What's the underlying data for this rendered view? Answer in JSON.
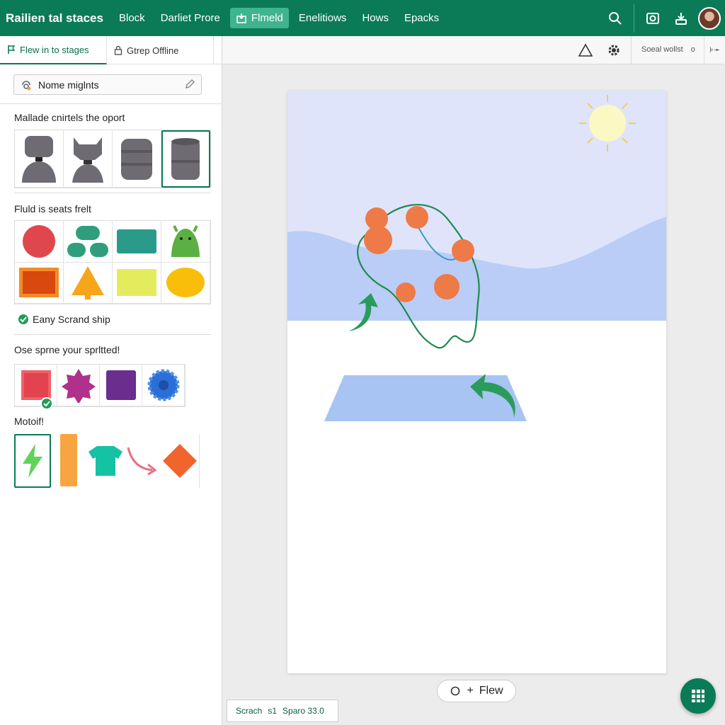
{
  "app": {
    "title": "Railien tal staces",
    "nav": [
      {
        "label": "Block",
        "active": false
      },
      {
        "label": "Darliet Prore",
        "active": false
      },
      {
        "label": "Flmeld",
        "active": true
      },
      {
        "label": "Enelitiows",
        "active": false
      },
      {
        "label": "Hows",
        "active": false
      },
      {
        "label": "Epacks",
        "active": false
      }
    ],
    "header_icons": [
      "search-icon",
      "camera-icon",
      "download-icon",
      "avatar"
    ]
  },
  "sidebar": {
    "tabs": [
      {
        "label": "Flew in to stages",
        "icon": "flag-icon",
        "active": true
      },
      {
        "label": "Gtrep Offline",
        "icon": "lock-icon",
        "active": false
      }
    ],
    "name_field": {
      "value": "Nome miglnts",
      "icon": "sprite-icon"
    },
    "section1": {
      "heading": "Mallade cnirtels the oport",
      "items": [
        "costume-1",
        "costume-2",
        "costume-3",
        "costume-4"
      ],
      "selected": 3
    },
    "section2": {
      "heading": "Fluld is seats frelt",
      "items": [
        "red-circle",
        "green-blob",
        "teal-rect",
        "green-monster",
        "orange-square",
        "orange-triangle",
        "yellow-rect",
        "yellow-ellipse"
      ]
    },
    "option": {
      "label": "Eany Scrand ship",
      "checked": true
    },
    "section3": {
      "heading": "Ose sprne your sprltted!",
      "items": [
        "pink-square",
        "magenta-star",
        "purple-square",
        "blue-gear"
      ],
      "selected": 0
    },
    "section4": {
      "heading": "Motoif!",
      "items": [
        "lightning",
        "orange-bar",
        "teal-shirt",
        "red-arrow",
        "orange-diamond"
      ],
      "selected": 0
    }
  },
  "toolbar": {
    "icons": [
      "warning-icon",
      "gear-icon"
    ],
    "seal_label": "Soeal wollst",
    "seal_suffix": "o",
    "end_label": "⊧➛"
  },
  "stage": {
    "colors": {
      "sky": "#dfe4fb",
      "hills": "#b9cdf6",
      "ground": "#ffffff",
      "sun": "#fbf8c4",
      "dots": "#ee7a47",
      "path": "#1f8a4e",
      "pad": "#a7c4f2"
    }
  },
  "footer": {
    "flew_button": "Flew",
    "status_left": "Scrach",
    "status_mid": "ѕ1",
    "status_right": "Sparo 33.0"
  },
  "colors": {
    "brand": "#0b7a57",
    "accent": "#3fb48e"
  }
}
